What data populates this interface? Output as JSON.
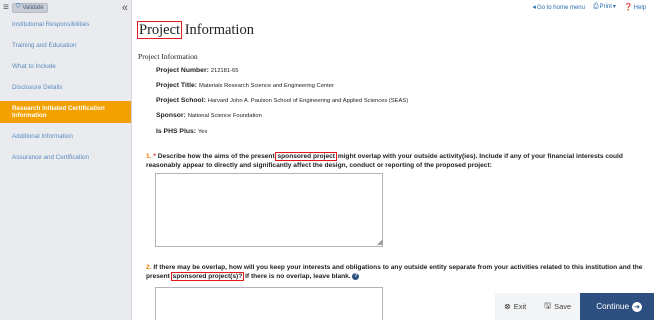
{
  "sidebar": {
    "menu_icon": "menu-icon",
    "logo_label": "Validate",
    "collapse_icon": "chevron-double-left-icon",
    "items": [
      {
        "label": "Institutional Responsibilities",
        "active": false
      },
      {
        "label": "Training and Education",
        "active": false
      },
      {
        "label": "What to Include",
        "active": false
      },
      {
        "label": "Disclosure Details",
        "active": false
      },
      {
        "label": "Research Initiated Certification Information",
        "active": true
      },
      {
        "label": "Additional Information",
        "active": false
      },
      {
        "label": "Assurance and Certification",
        "active": false
      }
    ]
  },
  "topbar": {
    "go_home": "Go to home menu",
    "print": "Print",
    "help": "Help"
  },
  "page_title": {
    "highlighted": "Project",
    "rest": " Information"
  },
  "section_title": "Project Information",
  "project": {
    "number_label": "Project Number:",
    "number_value": "212181-65",
    "title_label": "Project Title:",
    "title_value": "Materials Research Science and Engineering Center",
    "school_label": "Project School:",
    "school_value": "Harvard John A. Paulson School of Engineering and Applied Sciences (SEAS)",
    "sponsor_label": "Sponsor:",
    "sponsor_value": "National Science Foundation",
    "phs_label": "Is PHS Plus:",
    "phs_value": "Yes"
  },
  "questions": [
    {
      "number": "1.",
      "required": "*",
      "pre": "Describe how the aims of the present ",
      "highlight": "sponsored project",
      "post": " might overlap with your outside activity(ies). Include if any of your financial interests could reasonably appear to directly and significantly affect the design, conduct or reporting of the proposed project:",
      "value": ""
    },
    {
      "number": "2.",
      "pre": "If there may be overlap, how will you keep your interests and obligations to any outside entity separate from your activities related to this institution and the present ",
      "highlight": "sponsored project(s)?",
      "post": " If there is no overlap, leave blank.",
      "value": ""
    }
  ],
  "actions": {
    "exit": "Exit",
    "save": "Save",
    "continue": "Continue"
  },
  "colors": {
    "accent_orange": "#f2a100",
    "primary_navy": "#2d4f7f",
    "link_blue": "#5b8bc0",
    "highlight_red": "#e41a1a"
  }
}
